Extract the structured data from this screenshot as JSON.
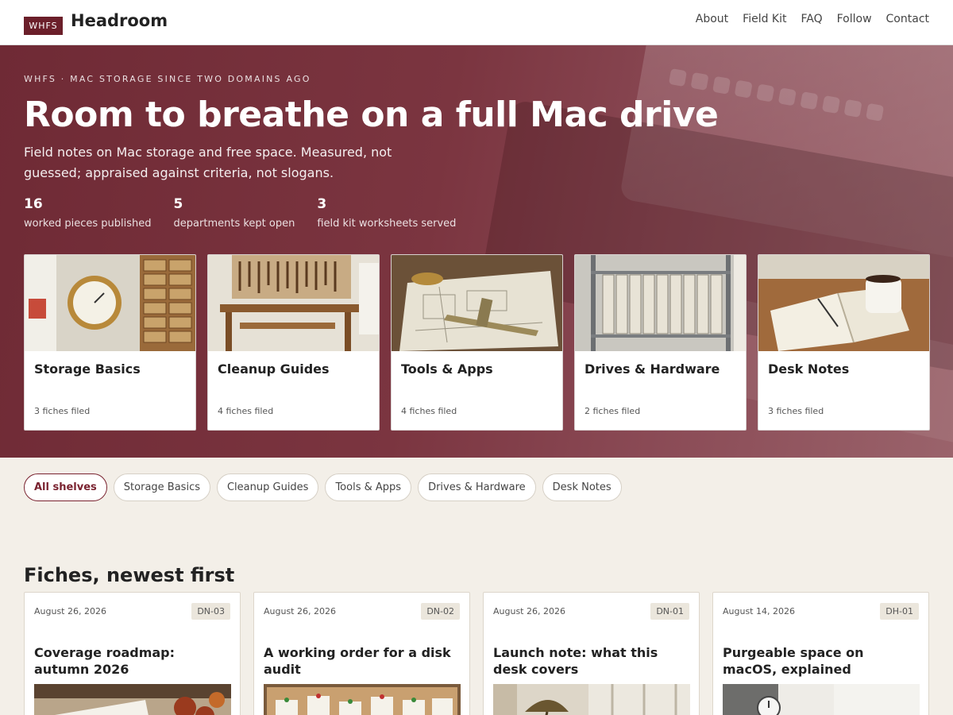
{
  "header": {
    "logo_badge": "WHFS",
    "site_name": "Headroom",
    "nav": [
      "About",
      "Field Kit",
      "FAQ",
      "Follow",
      "Contact"
    ]
  },
  "hero": {
    "eyebrow": "WHFS · MAC STORAGE SINCE TWO DOMAINS AGO",
    "title": "Room to breathe on a full Mac drive",
    "subtitle": "Field notes on Mac storage and free space. Measured, not guessed; appraised against criteria, not slogans.",
    "stats": [
      {
        "value": "16",
        "label": "worked pieces published"
      },
      {
        "value": "5",
        "label": "departments kept open"
      },
      {
        "value": "3",
        "label": "field kit worksheets served"
      }
    ]
  },
  "shelves": [
    {
      "name": "Storage Basics",
      "count": "3 fiches filed",
      "image": "pressure-gauge-and-drawers"
    },
    {
      "name": "Cleanup Guides",
      "count": "4 fiches filed",
      "image": "workbench-tools"
    },
    {
      "name": "Tools & Apps",
      "count": "4 fiches filed",
      "image": "caliper-on-blueprint"
    },
    {
      "name": "Drives & Hardware",
      "count": "2 fiches filed",
      "image": "binders-on-shelves"
    },
    {
      "name": "Desk Notes",
      "count": "3 fiches filed",
      "image": "notebook-and-mug"
    }
  ],
  "filters": {
    "active": "All shelves",
    "items": [
      "All shelves",
      "Storage Basics",
      "Cleanup Guides",
      "Tools & Apps",
      "Drives & Hardware",
      "Desk Notes"
    ]
  },
  "fiches_section": {
    "title": "Fiches, newest first",
    "items": [
      {
        "date": "August 26, 2026",
        "code": "DN-03",
        "title": "Coverage roadmap: autumn 2026",
        "image": "notebook-with-autumn-leaves"
      },
      {
        "date": "August 26, 2026",
        "code": "DN-02",
        "title": "A working order for a disk audit",
        "image": "corkboard-with-notes"
      },
      {
        "date": "August 26, 2026",
        "code": "DN-01",
        "title": "Launch note: what this desk covers",
        "image": "desk-lamp-by-window"
      },
      {
        "date": "August 14, 2026",
        "code": "DH-01",
        "title": "Purgeable space on macOS, explained",
        "image": "wall-clock-in-room"
      }
    ]
  },
  "colors": {
    "brand": "#6b1f2a",
    "hero_tint": "#7b3540",
    "page_bg": "#f3efe8",
    "active_chip": "#7a2330"
  }
}
